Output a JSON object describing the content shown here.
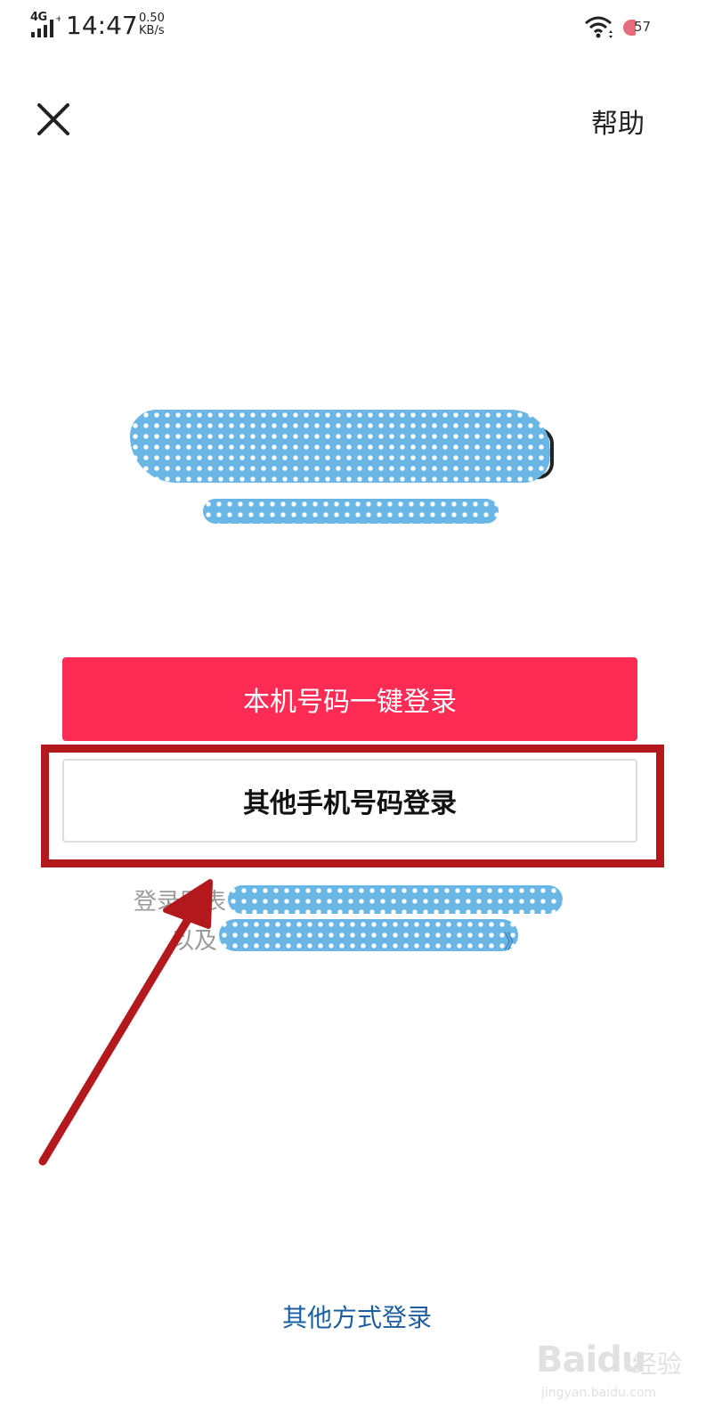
{
  "status_bar": {
    "network": "4G",
    "time": "14:47",
    "speed_value": "0.50",
    "speed_unit": "KB/s",
    "battery": "57",
    "icons": [
      "signal-icon",
      "wifi-icon",
      "battery-icon"
    ]
  },
  "header": {
    "close_icon": "close-icon",
    "help_label": "帮助"
  },
  "actions": {
    "primary_label": "本机号码一键登录",
    "secondary_label": "其他手机号码登录"
  },
  "terms": {
    "line1_prefix": "登录即表",
    "line2_prefix": "以及",
    "line2_suffix": "》"
  },
  "footer": {
    "other_login_label": "其他方式登录"
  },
  "watermark": {
    "brand": "Baidu",
    "cn": "经验",
    "url": "jingyan.baidu.com"
  },
  "colors": {
    "primary": "#fe2c55",
    "link": "#1c5fa0",
    "annotation": "#b3191c",
    "redaction": "#6ab6e4"
  }
}
